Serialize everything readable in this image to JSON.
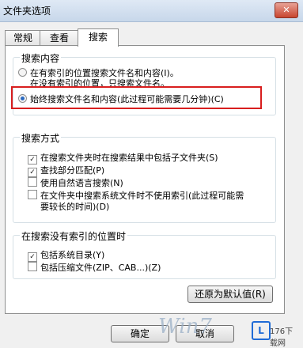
{
  "window": {
    "title": "文件夹选项",
    "close_glyph": "✕"
  },
  "tabs": [
    {
      "label": "常规"
    },
    {
      "label": "查看"
    },
    {
      "label": "搜索"
    }
  ],
  "search_content": {
    "title": "搜索内容",
    "option1_line1": "在有索引的位置搜索文件名和内容(I)。",
    "option1_line2": "在没有索引的位置，只搜索文件名。",
    "option2": "始终搜索文件名和内容(此过程可能需要几分钟)(C)"
  },
  "search_method": {
    "title": "搜索方式",
    "items": [
      {
        "label": "在搜索文件夹时在搜索结果中包括子文件夹(S)",
        "checked": true
      },
      {
        "label": "查找部分匹配(P)",
        "checked": true
      },
      {
        "label": "使用自然语言搜索(N)",
        "checked": false
      },
      {
        "label": "在文件夹中搜索系统文件时不使用索引(此过程可能需",
        "label_line2": "要较长的时间)(D)",
        "checked": false
      }
    ]
  },
  "no_index": {
    "title": "在搜索没有索引的位置时",
    "items": [
      {
        "label": "包括系统目录(Y)",
        "checked": true
      },
      {
        "label": "包括压缩文件(ZIP、CAB...)(Z)",
        "checked": false
      }
    ]
  },
  "buttons": {
    "restore": "还原为默认值(R)",
    "ok": "确定",
    "cancel": "取消"
  },
  "watermark": {
    "left_text": "Win7",
    "right_logo": "L",
    "right_text": "176下载网"
  }
}
